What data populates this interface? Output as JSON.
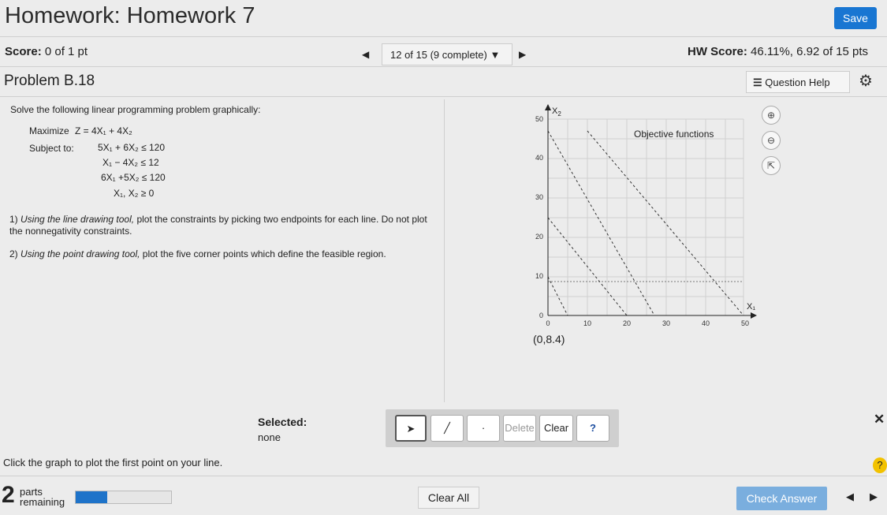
{
  "header": {
    "title": "Homework: Homework 7",
    "save_label": "Save"
  },
  "status": {
    "score_label": "Score:",
    "score_value": "0 of 1 pt",
    "nav_text": "12 of 15 (9 complete)",
    "hw_label": "HW Score:",
    "hw_value": "46.11%, 6.92 of 15 pts"
  },
  "problem": {
    "title": "Problem B.18",
    "question_help": "Question Help"
  },
  "question": {
    "intro": "Solve the following linear programming problem graphically:",
    "maximize_label": "Maximize",
    "objective": "Z = 4X₁ + 4X₂",
    "subject_label": "Subject to:",
    "constraints": [
      "5X₁ + 6X₂ ≤ 120",
      "X₁ − 4X₂ ≤ 12",
      "6X₁ +5X₂ ≤ 120",
      "X₁, X₂ ≥ 0"
    ],
    "step1_num": "1)",
    "step1_em": "Using the line drawing tool,",
    "step1_rest": "plot the constraints by picking two endpoints for each line. Do not plot the nonnegativity constraints.",
    "step2_num": "2)",
    "step2_em": "Using the point drawing tool,",
    "step2_rest": "plot the five corner points which define the feasible region."
  },
  "graph": {
    "x_label": "X₁",
    "x2": "X",
    "x2_sub": "2",
    "x_ticks": [
      "0",
      "10",
      "20",
      "30",
      "40",
      "50"
    ],
    "y_ticks": [
      "0",
      "10",
      "20",
      "30",
      "40",
      "50"
    ],
    "objective_label": "Objective functions",
    "coordinate": "(0,8.4)"
  },
  "selection": {
    "label": "Selected:",
    "value": "none"
  },
  "toolbar": {
    "delete": "Delete",
    "clear": "Clear",
    "help": "?"
  },
  "footer": {
    "hint": "Click the graph to plot the first point on your line.",
    "parts_count": "2",
    "parts_word": "parts",
    "parts_remaining": "remaining",
    "progress": 0.33,
    "clear_all": "Clear All",
    "check_answer": "Check Answer"
  },
  "colors": {
    "accent": "#1976d2",
    "check": "#7aaede",
    "help": "#f2c200"
  }
}
